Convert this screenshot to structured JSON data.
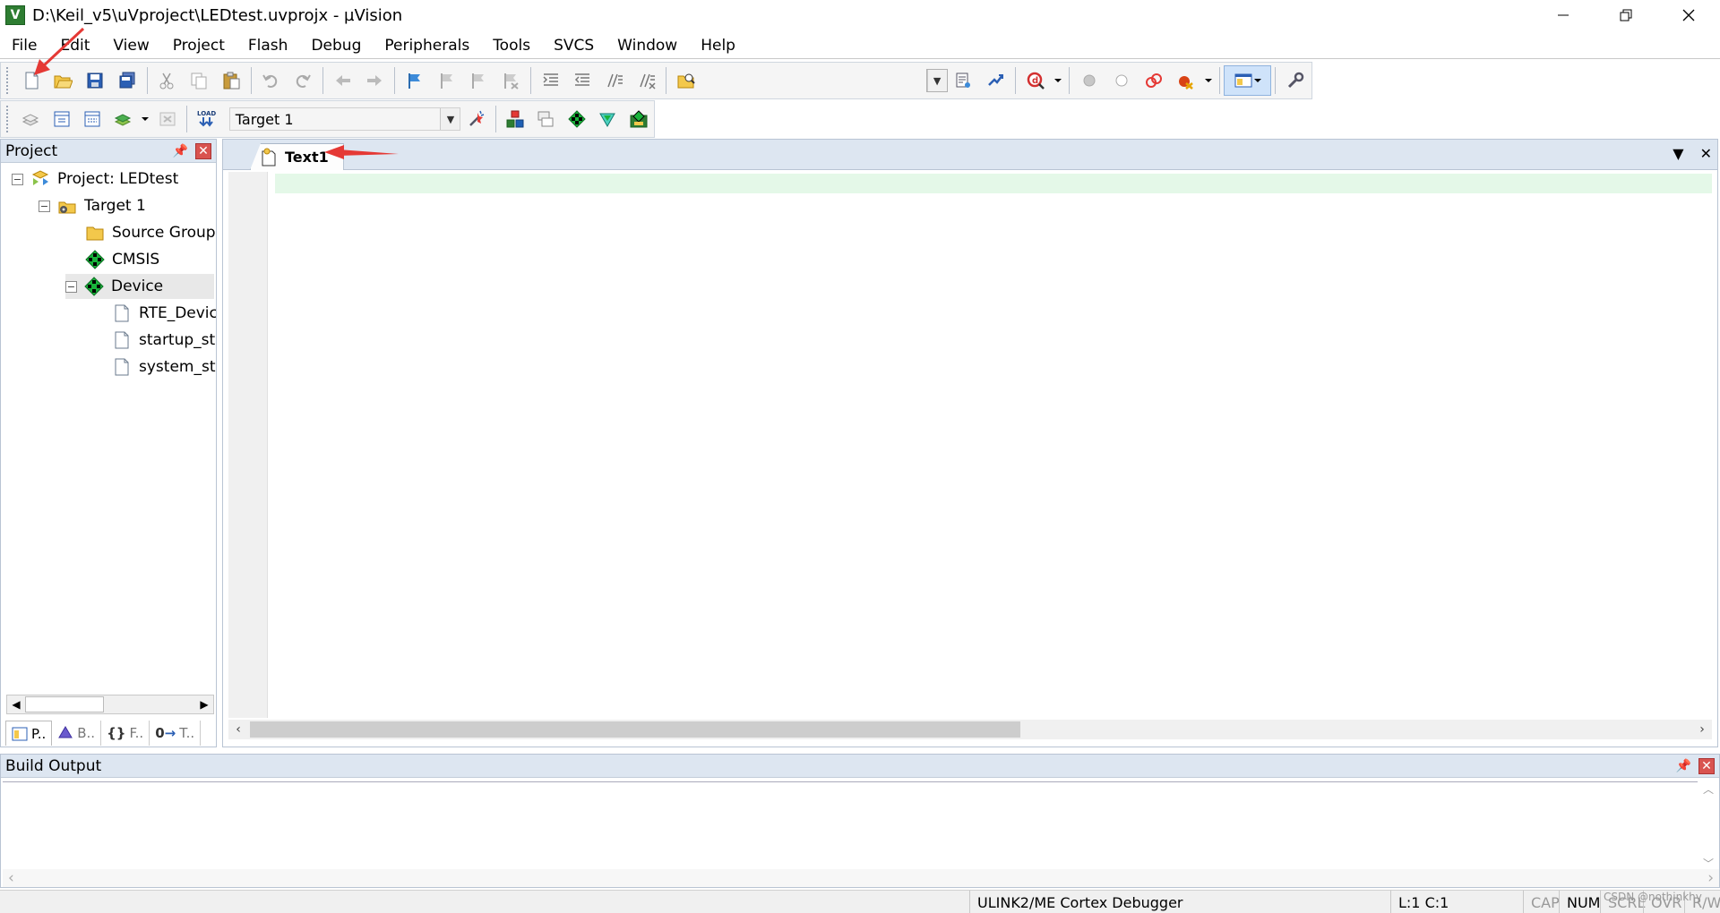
{
  "window": {
    "title": "D:\\Keil_v5\\uVproject\\LEDtest.uvprojx - µVision",
    "app_icon_letter": "V"
  },
  "menu": [
    "File",
    "Edit",
    "View",
    "Project",
    "Flash",
    "Debug",
    "Peripherals",
    "Tools",
    "SVCS",
    "Window",
    "Help"
  ],
  "toolbar2": {
    "target_value": "Target 1"
  },
  "project_pane": {
    "title": "Project",
    "tree": [
      {
        "label": "Project: LEDtest",
        "icon": "project-icon"
      },
      {
        "label": "Target 1",
        "icon": "target-icon"
      },
      {
        "label": "Source Group",
        "icon": "folder-icon"
      },
      {
        "label": "CMSIS",
        "icon": "component-icon"
      },
      {
        "label": "Device",
        "icon": "component-icon",
        "selected": true
      },
      {
        "label": "RTE_Devic",
        "icon": "file-icon"
      },
      {
        "label": "startup_st",
        "icon": "file-icon"
      },
      {
        "label": "system_st",
        "icon": "file-icon"
      }
    ],
    "tabs": [
      "P..",
      "B..",
      "F..",
      "T.."
    ]
  },
  "editor": {
    "active_tab": "Text1"
  },
  "build_output": {
    "title": "Build Output"
  },
  "status": {
    "debugger": "ULINK2/ME Cortex Debugger",
    "position": "L:1 C:1",
    "cap": "CAP",
    "num": "NUM",
    "scrl": "SCRL",
    "ovr": "OVR",
    "rw": "R/W",
    "watermark": "CSDN @nothinkhy"
  },
  "colors": {
    "pane_header": "#dde6f1",
    "current_line": "#e4f8e8",
    "annotation_arrow": "#e53935"
  }
}
